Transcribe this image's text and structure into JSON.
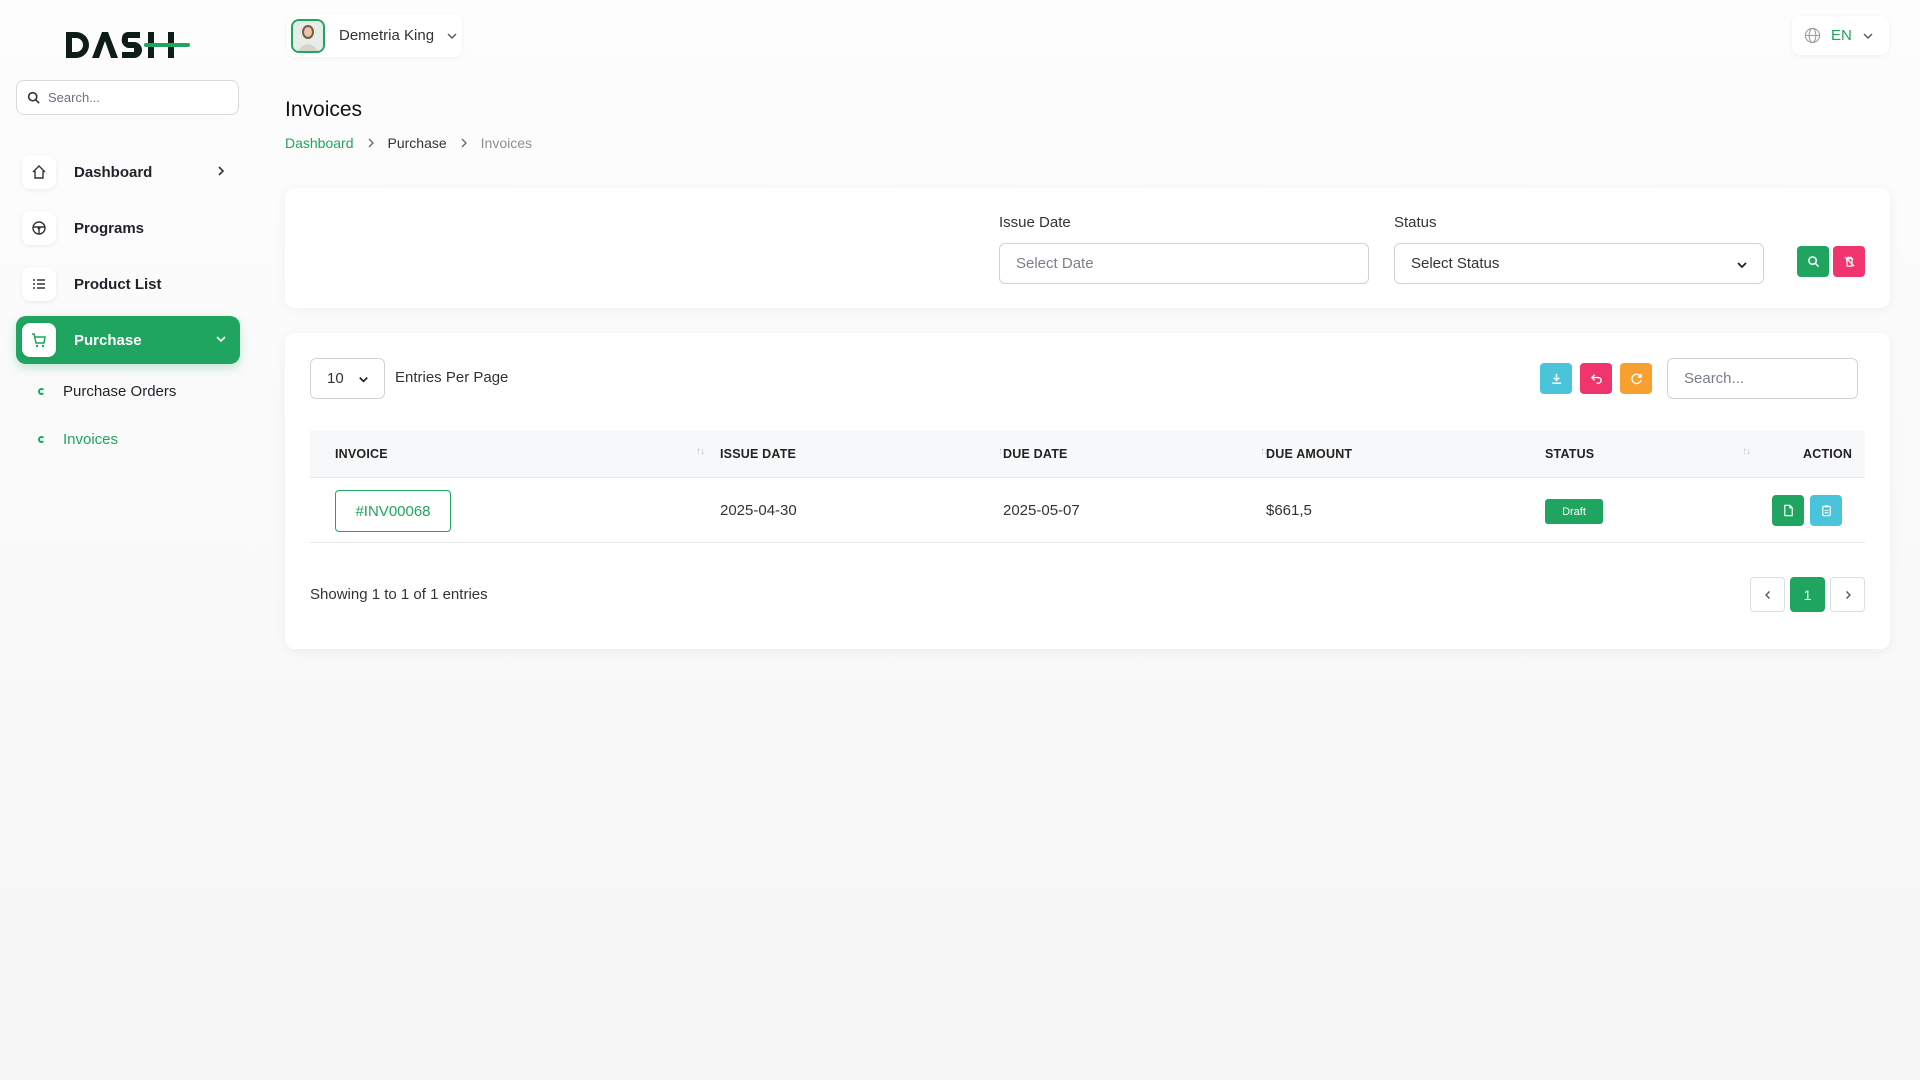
{
  "brand": {
    "logo_text": "DASH",
    "accent": "#1fa55f"
  },
  "sidebar": {
    "search_placeholder": "Search...",
    "items": [
      {
        "label": "Dashboard",
        "icon": "home-icon"
      },
      {
        "label": "Programs",
        "icon": "steering-wheel-icon"
      },
      {
        "label": "Product List",
        "icon": "list-icon"
      },
      {
        "label": "Purchase",
        "icon": "cart-icon",
        "active": true
      }
    ],
    "sub_items": [
      {
        "label": "Purchase Orders"
      },
      {
        "label": "Invoices",
        "active": true
      }
    ]
  },
  "header": {
    "user_name": "Demetria King",
    "language": "EN"
  },
  "page": {
    "title": "Invoices",
    "breadcrumb": [
      "Dashboard",
      "Purchase",
      "Invoices"
    ]
  },
  "filters": {
    "issue_date_label": "Issue Date",
    "issue_date_placeholder": "Select Date",
    "status_label": "Status",
    "status_value": "Select Status"
  },
  "table": {
    "per_page": "10",
    "per_page_label": "Entries Per Page",
    "search_placeholder": "Search...",
    "columns": [
      "INVOICE",
      "ISSUE DATE",
      "DUE DATE",
      "DUE AMOUNT",
      "STATUS",
      "ACTION"
    ],
    "rows": [
      {
        "invoice": "#INV00068",
        "issue_date": "2025-04-30",
        "due_date": "2025-05-07",
        "due_amount": "$661,5",
        "status": "Draft"
      }
    ],
    "showing": "Showing 1 to 1 of 1 entries",
    "current_page": "1"
  },
  "colors": {
    "green": "#1fa55f",
    "pink": "#f0356e",
    "cyan": "#4ac4db",
    "orange": "#f7a030"
  }
}
